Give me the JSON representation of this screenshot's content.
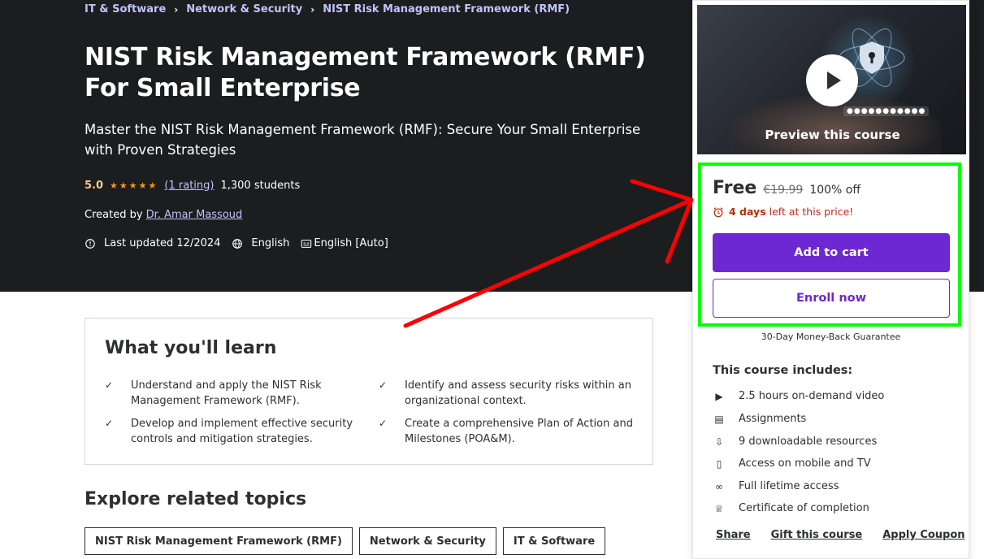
{
  "breadcrumb": [
    {
      "label": "IT & Software"
    },
    {
      "label": "Network & Security"
    },
    {
      "label": "NIST Risk Management Framework (RMF)"
    }
  ],
  "course": {
    "title": "NIST Risk Management Framework (RMF) For Small Enterprise",
    "subtitle": "Master the NIST Risk Management Framework (RMF): Secure Your Small Enterprise with Proven Strategies",
    "rating": "5.0",
    "rating_count": "(1 rating)",
    "students": "1,300 students",
    "created_by_label": "Created by",
    "instructor": "Dr. Amar Massoud",
    "last_updated": "Last updated 12/2024",
    "language": "English",
    "captions": "English [Auto]"
  },
  "learn": {
    "title": "What you'll learn",
    "items": [
      "Understand and apply the NIST Risk Management Framework (RMF).",
      "Identify and assess security risks within an organizational context.",
      "Develop and implement effective security controls and mitigation strategies.",
      "Create a comprehensive Plan of Action and Milestones (POA&M)."
    ]
  },
  "explore": {
    "title": "Explore related topics",
    "topics": [
      "NIST Risk Management Framework (RMF)",
      "Network & Security",
      "IT & Software"
    ]
  },
  "card": {
    "preview_label": "Preview this course",
    "price": "Free",
    "original_price": "€19.99",
    "discount": "100% off",
    "timer_bold": "4 days",
    "timer_rest": "left at this price!",
    "add_to_cart": "Add to cart",
    "enroll": "Enroll now",
    "guarantee": "30-Day Money-Back Guarantee",
    "includes_title": "This course includes:",
    "includes": [
      {
        "icon": "video-icon",
        "label": "2.5 hours on-demand video"
      },
      {
        "icon": "assignment-icon",
        "label": "Assignments"
      },
      {
        "icon": "download-file-icon",
        "label": "9 downloadable resources"
      },
      {
        "icon": "mobile-icon",
        "label": "Access on mobile and TV"
      },
      {
        "icon": "infinity-icon",
        "label": "Full lifetime access"
      },
      {
        "icon": "trophy-icon",
        "label": "Certificate of completion"
      }
    ],
    "links": [
      "Share",
      "Gift this course",
      "Apply Coupon"
    ]
  },
  "annotation": {
    "highlight_color": "#00ff00",
    "arrow_color": "#ff0000"
  },
  "colors": {
    "hero_bg": "#1c1d1f",
    "accent": "#6d28d2",
    "link": "#c0c4fc",
    "star": "#f69c08"
  }
}
